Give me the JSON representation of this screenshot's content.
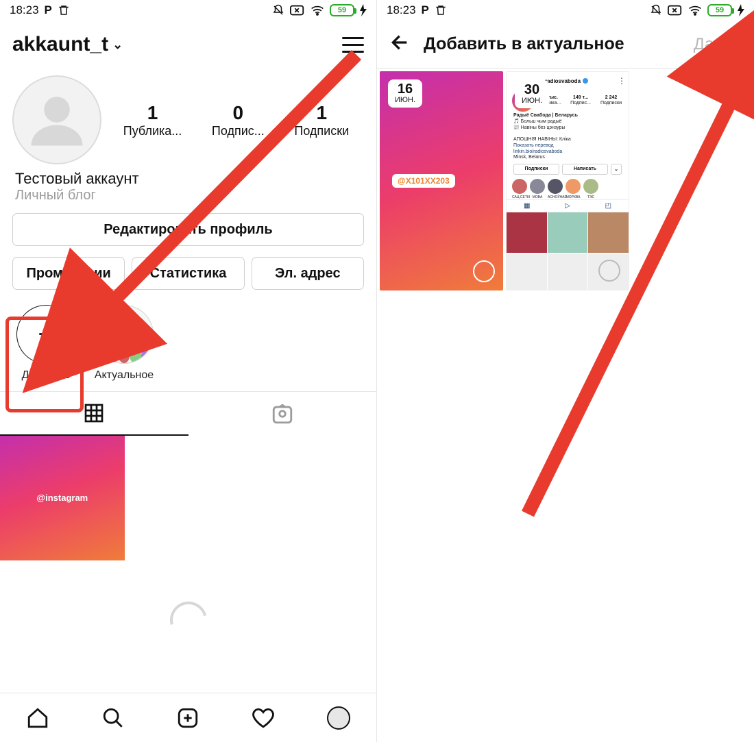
{
  "statusbar": {
    "time": "18:23",
    "battery": "59"
  },
  "left": {
    "username": "akkaunt_t",
    "stats": {
      "posts_n": "1",
      "posts_l": "Публика...",
      "followers_n": "0",
      "followers_l": "Подпис...",
      "following_n": "1",
      "following_l": "Подписки"
    },
    "bio": {
      "name": "Тестовый аккаунт",
      "sub": "Личный блог"
    },
    "buttons": {
      "edit": "Редактировать профиль",
      "promo": "Промоакции",
      "stats": "Статистика",
      "email": "Эл. адрес"
    },
    "highlights": {
      "add": "Добавить",
      "actual": "Актуальное"
    },
    "post_label": "@instagram"
  },
  "right": {
    "title": "Добавить в актуальное",
    "next": "Далее",
    "story1": {
      "day": "16",
      "month": "июн.",
      "mention": "@X101XX203"
    },
    "story2": {
      "day": "30",
      "month": "ИЮН.",
      "account": "radiosvaboda",
      "nums": {
        "a": "11 тыс.",
        "al": "Публика...",
        "b": "149 т...",
        "bl": "Подпис...",
        "c": "2 242",
        "cl": "Подписки"
      },
      "bio_name": "Радыё Свабода | Беларусь",
      "bio_l1": "🎵 Больш чым радыё",
      "bio_l2": "📰 Навіны без цэнзуры",
      "bio_l3": "АПОШНІЯ НАВІНЫ: Кліка",
      "bio_l4": "Показать перевод",
      "bio_l5": "linkin.bio/radiosvaboda",
      "bio_l6": "Minsk, Belarus",
      "btn_follow": "Подписки",
      "btn_msg": "Написать",
      "hl": [
        "САЦ.СЕТКІ",
        "МОВА",
        "АСНОЎНАЕ",
        "МОРКВА",
        "ТЭС"
      ]
    }
  }
}
